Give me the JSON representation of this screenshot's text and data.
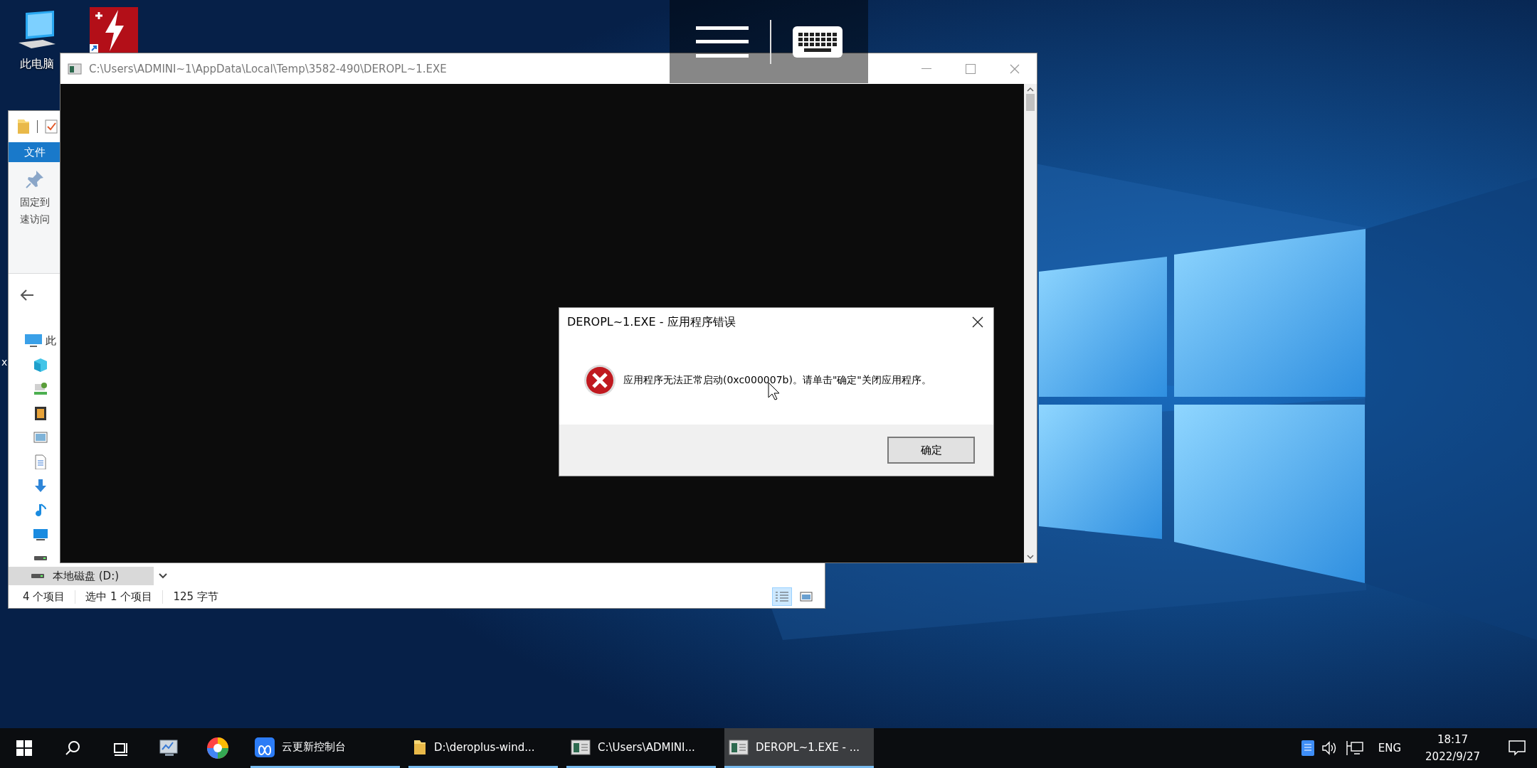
{
  "desktop": {
    "icons": [
      {
        "label": "此电脑"
      }
    ],
    "label_fragments": [
      "x"
    ]
  },
  "explorer": {
    "ribbon_tab": "文件",
    "pin_label_lines": [
      "固定到",
      "速访问"
    ],
    "tree_root_label": "此",
    "drive": {
      "label": "本地磁盘 (D:)",
      "selected": true
    },
    "status_items": [
      "4 个项目",
      "选中 1 个项目",
      "125 字节"
    ]
  },
  "console": {
    "title": "C:\\Users\\ADMINI~1\\AppData\\Local\\Temp\\3582-490\\DEROPL~1.EXE"
  },
  "dialog": {
    "title": "DEROPL~1.EXE - 应用程序错误",
    "message": "应用程序无法正常启动(0xc000007b)。请单击\"确定\"关闭应用程序。",
    "button": "确定"
  },
  "taskbar": {
    "items": [
      {
        "kind": "app",
        "label": "云更新控制台",
        "selected": false
      },
      {
        "kind": "folder",
        "label": "D:\\deroplus-wind...",
        "selected": false
      },
      {
        "kind": "console",
        "label": "C:\\Users\\ADMINI...",
        "selected": false
      },
      {
        "kind": "console",
        "label": "DEROPL~1.EXE - ...",
        "selected": true
      }
    ],
    "tray": {
      "language": "ENG",
      "time": "18:17",
      "date": "2022/9/27"
    }
  }
}
